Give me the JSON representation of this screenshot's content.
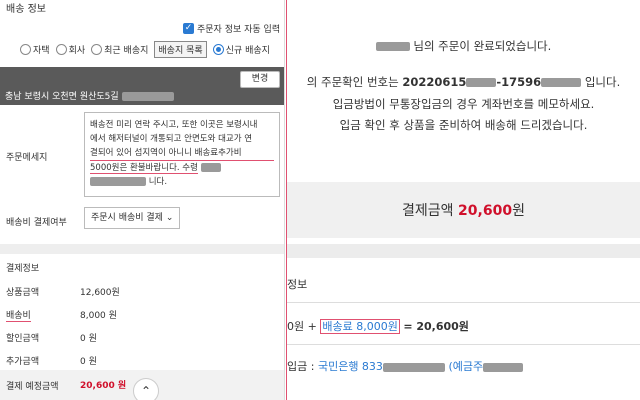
{
  "left": {
    "section_title": "배송 정보",
    "auto_input_label": "주문자 정보 자동 입력",
    "radio_options": [
      "자택",
      "회사",
      "최근 배송지"
    ],
    "list_button": "배송지 목록",
    "new_radio": "신규 배송지",
    "address": "충남 보령시 오천면 원산도5길",
    "change_button": "변경",
    "memo_label": "주문메세지",
    "memo_lines": [
      "배송전  미리 연락 주시고, 또한 이곳은 보령시내",
      "에서 해저터널이 개통되고 안면도와 대교가  연",
      "결되어 있어  섬지역이 아니니 배송료추가비",
      "5000원은 환불바랍니다. 수령",
      "니다."
    ],
    "shipping_pay_label": "배송비 결제여부",
    "shipping_pay_value": "주문시 배송비 결제",
    "pay_section_title": "결제정보",
    "rows": [
      {
        "label": "상품금액",
        "value": "12,600원"
      },
      {
        "label": "배송비",
        "value": "8,000 원"
      },
      {
        "label": "할인금액",
        "value": "0 원"
      },
      {
        "label": "추가금액",
        "value": "0 원"
      }
    ],
    "total_label": "결제 예정금액",
    "total_value": "20,600 원"
  },
  "right": {
    "line1": "님의 주문이 완료되었습니다.",
    "line2_prefix": "의 주문확인 번호는",
    "order_no_a": "20220615",
    "order_no_b": "-17596",
    "line2_suffix": "입니다.",
    "line3": "입금방법이 무통장입금의 경우 계좌번호를 메모하세요.",
    "line4": "입금 확인 후 상품을 준비하여 배송해 드리겠습니다.",
    "amount_label": "결제금액",
    "amount_value": "20,600",
    "amount_unit": "원",
    "info_title": "정보",
    "calc_prefix": "0원 +",
    "calc_box": "배송료 8,000원",
    "calc_suffix": "= 20,600원",
    "bank_prefix": "입금 :",
    "bank_value": "국민은행 833",
    "bank_suffix": "(예금주"
  }
}
